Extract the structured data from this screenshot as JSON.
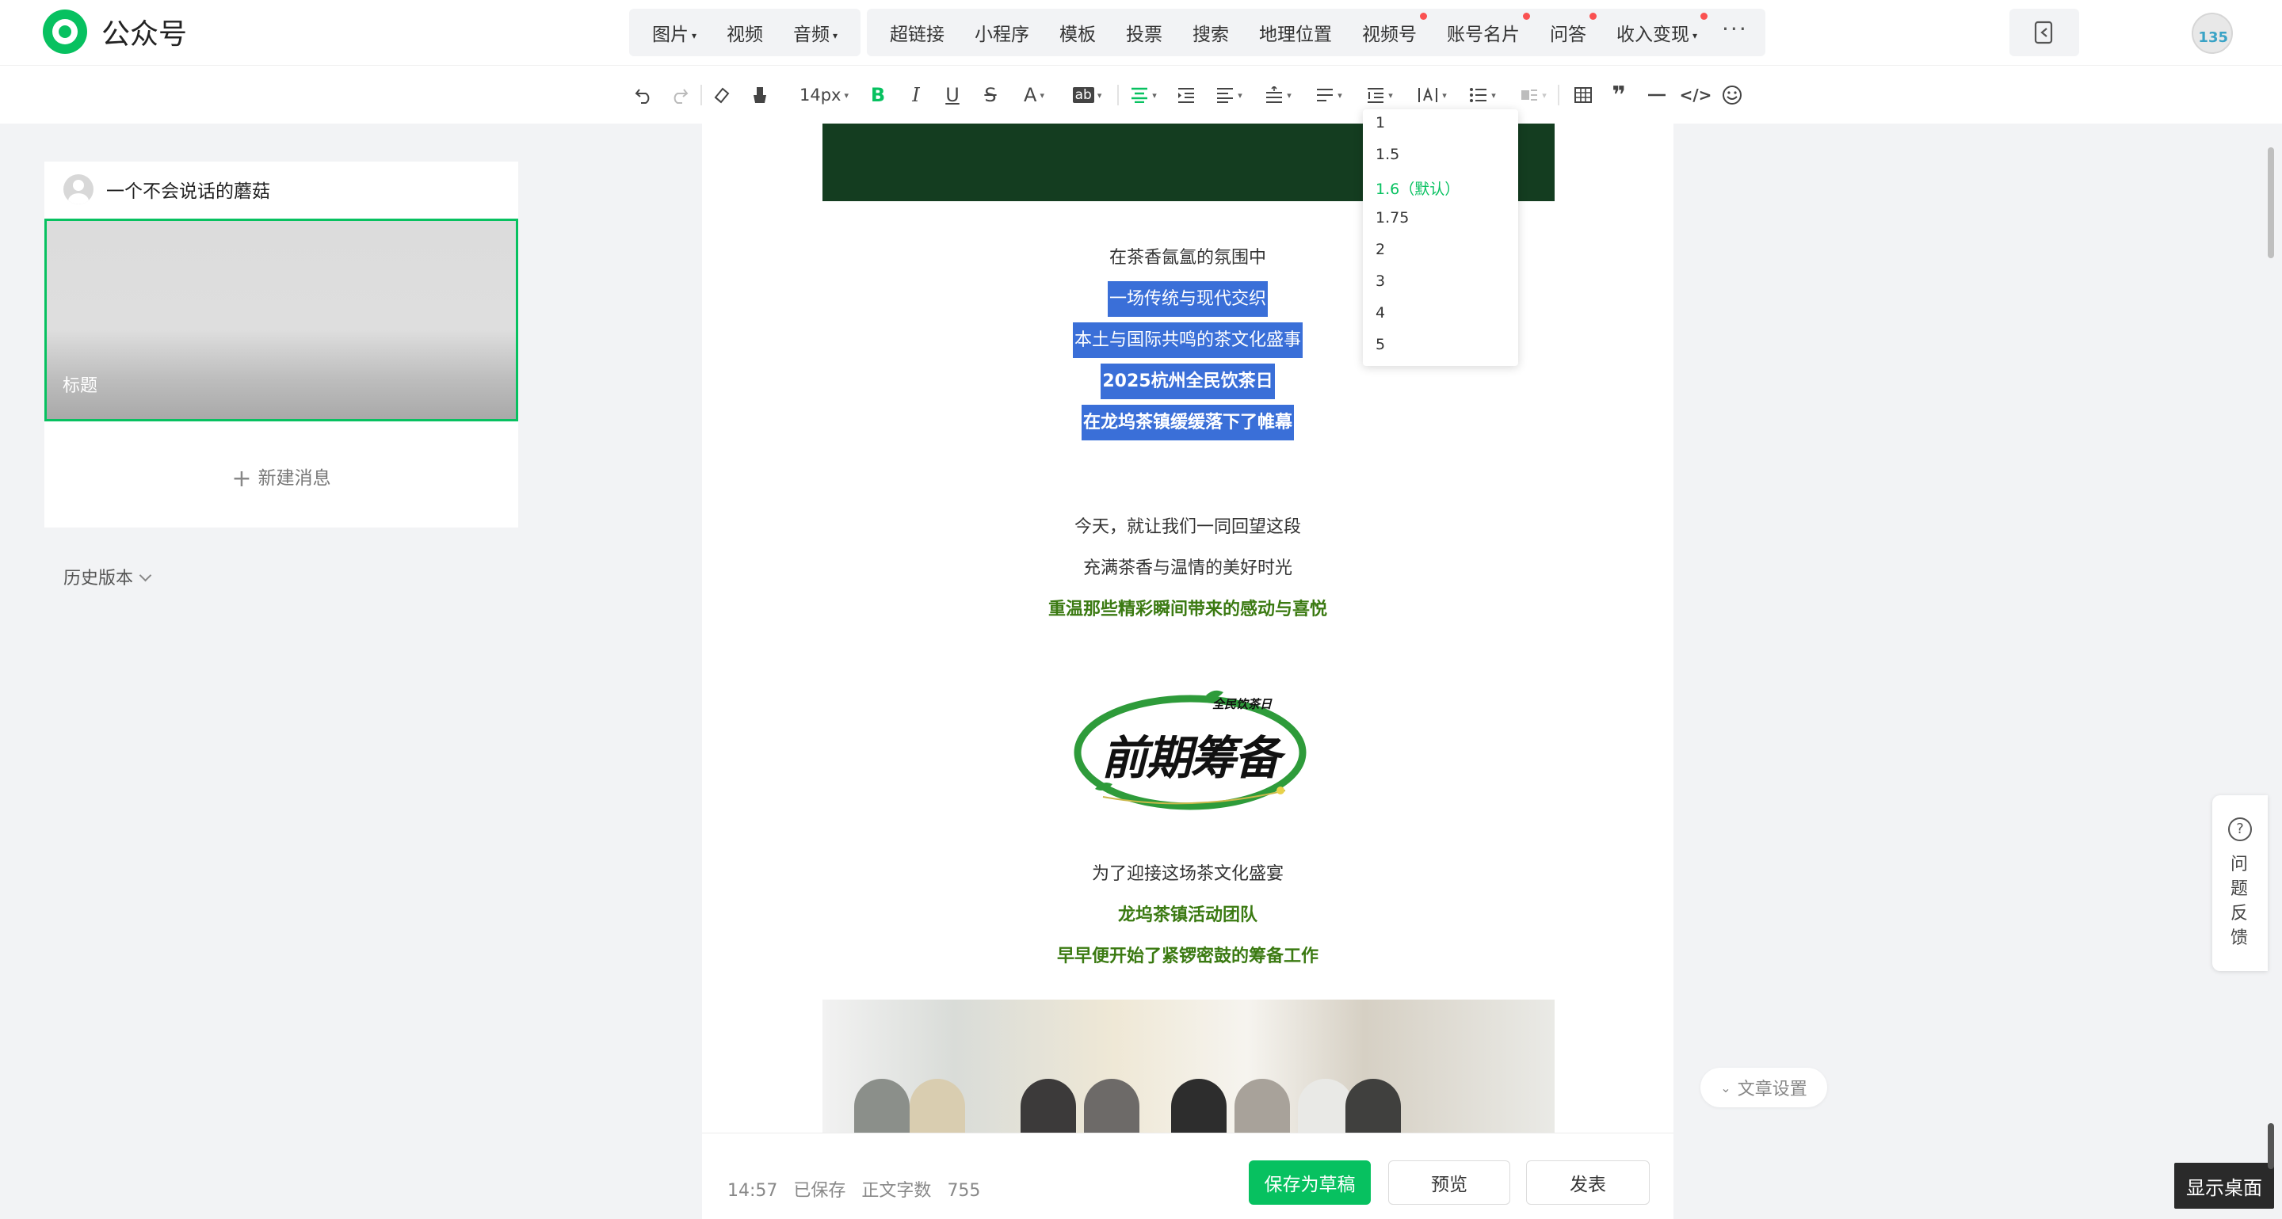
{
  "app": {
    "title": "公众号"
  },
  "topbar": {
    "media_group": [
      {
        "label": "图片",
        "caret": true
      },
      {
        "label": "视频",
        "caret": false
      },
      {
        "label": "音频",
        "caret": true
      }
    ],
    "insert_group": [
      {
        "label": "超链接",
        "dot": false,
        "caret": false
      },
      {
        "label": "小程序",
        "dot": false,
        "caret": false
      },
      {
        "label": "模板",
        "dot": false,
        "caret": false
      },
      {
        "label": "投票",
        "dot": false,
        "caret": false
      },
      {
        "label": "搜索",
        "dot": false,
        "caret": false
      },
      {
        "label": "地理位置",
        "dot": false,
        "caret": false
      },
      {
        "label": "视频号",
        "dot": true,
        "caret": false
      },
      {
        "label": "账号名片",
        "dot": true,
        "caret": false
      },
      {
        "label": "问答",
        "dot": true,
        "caret": false
      },
      {
        "label": "收入变现",
        "dot": true,
        "caret": true
      }
    ],
    "more": "···",
    "avatar_text": "135"
  },
  "toolbar": {
    "font_size": "14px",
    "bold": "B",
    "italic": "I",
    "underline": "U",
    "strike": "S",
    "font_color": "A",
    "bg_color": "ab",
    "quote": "❞",
    "code": "</>"
  },
  "left": {
    "account_name": "一个不会说话的蘑菇",
    "article_title": "标题",
    "new_message": "新建消息",
    "history": "历史版本"
  },
  "editor": {
    "lines": {
      "l1": "在茶香氤氲的氛围中",
      "l2": "一场传统与现代交织",
      "l3": "本土与国际共鸣的茶文化盛事",
      "l4": "2025杭州全民饮茶日",
      "l5": "在龙坞茶镇缓缓落下了帷幕",
      "l6": "今天，就让我们一同回望这段",
      "l7": "充满茶香与温情的美好时光",
      "l8": "重温那些精彩瞬间带来的感动与喜悦",
      "l9": "为了迎接这场茶文化盛宴",
      "l10": "龙坞茶镇活动团队",
      "l11": "早早便开始了紧锣密鼓的筹备工作"
    },
    "hero": {
      "main": "前期筹备",
      "sub": "全民饮茶日"
    }
  },
  "line_height_menu": {
    "options": [
      "1",
      "1.5",
      "1.6（默认）",
      "1.75",
      "2",
      "3",
      "4",
      "5"
    ],
    "selected": "1.6（默认）"
  },
  "bottom": {
    "time": "14:57",
    "saved": "已保存",
    "word_count_label": "正文字数",
    "word_count": "755",
    "save_draft": "保存为草稿",
    "preview": "预览",
    "publish": "发表"
  },
  "article_settings": "文章设置",
  "feedback": "问题反馈",
  "show_desktop": "显示桌面",
  "colors": {
    "accent": "#07c160",
    "selection": "#3a6fd8",
    "text_green": "#3b7a12",
    "banner": "#143d20"
  }
}
